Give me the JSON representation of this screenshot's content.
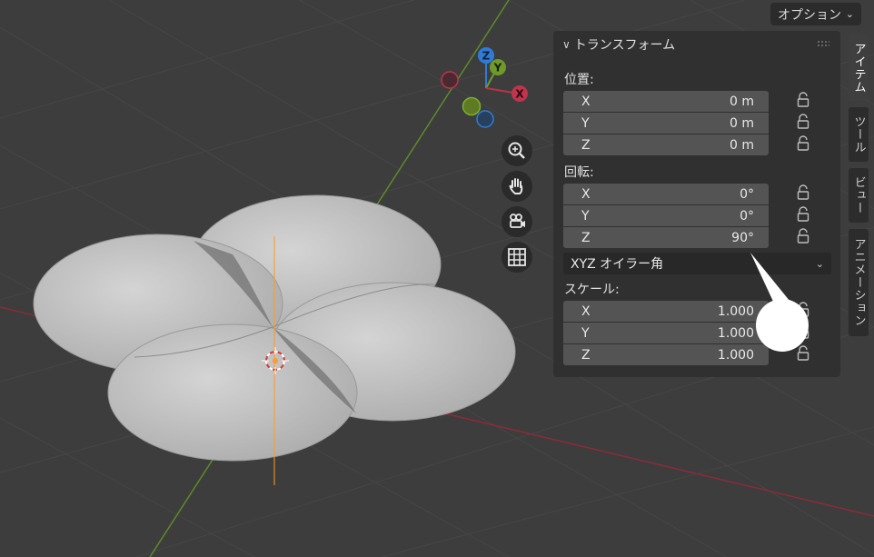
{
  "header": {
    "options_label": "オプション"
  },
  "gizmo": {
    "x_label": "X",
    "y_label": "Y",
    "z_label": "Z"
  },
  "nav_icons": [
    "zoom-icon",
    "hand-pan-icon",
    "camera-icon",
    "grid-icon"
  ],
  "panel": {
    "title": "トランスフォーム",
    "location": {
      "label": "位置:",
      "rows": [
        {
          "axis": "X",
          "value": "0 m"
        },
        {
          "axis": "Y",
          "value": "0 m"
        },
        {
          "axis": "Z",
          "value": "0 m"
        }
      ]
    },
    "rotation": {
      "label": "回転:",
      "rows": [
        {
          "axis": "X",
          "value": "0°"
        },
        {
          "axis": "Y",
          "value": "0°"
        },
        {
          "axis": "Z",
          "value": "90°"
        }
      ],
      "mode": "XYZ オイラー角"
    },
    "scale": {
      "label": "スケール:",
      "rows": [
        {
          "axis": "X",
          "value": "1.000"
        },
        {
          "axis": "Y",
          "value": "1.000"
        },
        {
          "axis": "Z",
          "value": "1.000"
        }
      ]
    }
  },
  "tabs": [
    {
      "label": "アイテム",
      "active": true
    },
    {
      "label": "ツール",
      "active": false
    },
    {
      "label": "ビュー",
      "active": false
    },
    {
      "label": "アニメーション",
      "active": false
    }
  ],
  "colors": {
    "x_axis": "#b8334a",
    "y_axis": "#6f9a2a",
    "z_axis": "#2f7bd6",
    "object_origin": "#ff9a2a"
  }
}
